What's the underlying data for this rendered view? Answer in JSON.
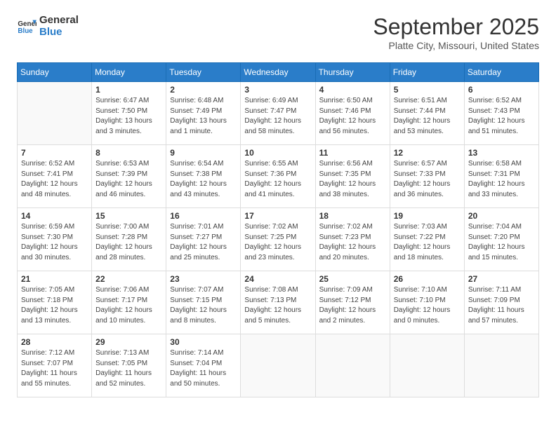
{
  "logo": {
    "line1": "General",
    "line2": "Blue"
  },
  "title": "September 2025",
  "location": "Platte City, Missouri, United States",
  "days_header": [
    "Sunday",
    "Monday",
    "Tuesday",
    "Wednesday",
    "Thursday",
    "Friday",
    "Saturday"
  ],
  "weeks": [
    [
      {
        "day": "",
        "info": ""
      },
      {
        "day": "1",
        "info": "Sunrise: 6:47 AM\nSunset: 7:50 PM\nDaylight: 13 hours\nand 3 minutes."
      },
      {
        "day": "2",
        "info": "Sunrise: 6:48 AM\nSunset: 7:49 PM\nDaylight: 13 hours\nand 1 minute."
      },
      {
        "day": "3",
        "info": "Sunrise: 6:49 AM\nSunset: 7:47 PM\nDaylight: 12 hours\nand 58 minutes."
      },
      {
        "day": "4",
        "info": "Sunrise: 6:50 AM\nSunset: 7:46 PM\nDaylight: 12 hours\nand 56 minutes."
      },
      {
        "day": "5",
        "info": "Sunrise: 6:51 AM\nSunset: 7:44 PM\nDaylight: 12 hours\nand 53 minutes."
      },
      {
        "day": "6",
        "info": "Sunrise: 6:52 AM\nSunset: 7:43 PM\nDaylight: 12 hours\nand 51 minutes."
      }
    ],
    [
      {
        "day": "7",
        "info": "Sunrise: 6:52 AM\nSunset: 7:41 PM\nDaylight: 12 hours\nand 48 minutes."
      },
      {
        "day": "8",
        "info": "Sunrise: 6:53 AM\nSunset: 7:39 PM\nDaylight: 12 hours\nand 46 minutes."
      },
      {
        "day": "9",
        "info": "Sunrise: 6:54 AM\nSunset: 7:38 PM\nDaylight: 12 hours\nand 43 minutes."
      },
      {
        "day": "10",
        "info": "Sunrise: 6:55 AM\nSunset: 7:36 PM\nDaylight: 12 hours\nand 41 minutes."
      },
      {
        "day": "11",
        "info": "Sunrise: 6:56 AM\nSunset: 7:35 PM\nDaylight: 12 hours\nand 38 minutes."
      },
      {
        "day": "12",
        "info": "Sunrise: 6:57 AM\nSunset: 7:33 PM\nDaylight: 12 hours\nand 36 minutes."
      },
      {
        "day": "13",
        "info": "Sunrise: 6:58 AM\nSunset: 7:31 PM\nDaylight: 12 hours\nand 33 minutes."
      }
    ],
    [
      {
        "day": "14",
        "info": "Sunrise: 6:59 AM\nSunset: 7:30 PM\nDaylight: 12 hours\nand 30 minutes."
      },
      {
        "day": "15",
        "info": "Sunrise: 7:00 AM\nSunset: 7:28 PM\nDaylight: 12 hours\nand 28 minutes."
      },
      {
        "day": "16",
        "info": "Sunrise: 7:01 AM\nSunset: 7:27 PM\nDaylight: 12 hours\nand 25 minutes."
      },
      {
        "day": "17",
        "info": "Sunrise: 7:02 AM\nSunset: 7:25 PM\nDaylight: 12 hours\nand 23 minutes."
      },
      {
        "day": "18",
        "info": "Sunrise: 7:02 AM\nSunset: 7:23 PM\nDaylight: 12 hours\nand 20 minutes."
      },
      {
        "day": "19",
        "info": "Sunrise: 7:03 AM\nSunset: 7:22 PM\nDaylight: 12 hours\nand 18 minutes."
      },
      {
        "day": "20",
        "info": "Sunrise: 7:04 AM\nSunset: 7:20 PM\nDaylight: 12 hours\nand 15 minutes."
      }
    ],
    [
      {
        "day": "21",
        "info": "Sunrise: 7:05 AM\nSunset: 7:18 PM\nDaylight: 12 hours\nand 13 minutes."
      },
      {
        "day": "22",
        "info": "Sunrise: 7:06 AM\nSunset: 7:17 PM\nDaylight: 12 hours\nand 10 minutes."
      },
      {
        "day": "23",
        "info": "Sunrise: 7:07 AM\nSunset: 7:15 PM\nDaylight: 12 hours\nand 8 minutes."
      },
      {
        "day": "24",
        "info": "Sunrise: 7:08 AM\nSunset: 7:13 PM\nDaylight: 12 hours\nand 5 minutes."
      },
      {
        "day": "25",
        "info": "Sunrise: 7:09 AM\nSunset: 7:12 PM\nDaylight: 12 hours\nand 2 minutes."
      },
      {
        "day": "26",
        "info": "Sunrise: 7:10 AM\nSunset: 7:10 PM\nDaylight: 12 hours\nand 0 minutes."
      },
      {
        "day": "27",
        "info": "Sunrise: 7:11 AM\nSunset: 7:09 PM\nDaylight: 11 hours\nand 57 minutes."
      }
    ],
    [
      {
        "day": "28",
        "info": "Sunrise: 7:12 AM\nSunset: 7:07 PM\nDaylight: 11 hours\nand 55 minutes."
      },
      {
        "day": "29",
        "info": "Sunrise: 7:13 AM\nSunset: 7:05 PM\nDaylight: 11 hours\nand 52 minutes."
      },
      {
        "day": "30",
        "info": "Sunrise: 7:14 AM\nSunset: 7:04 PM\nDaylight: 11 hours\nand 50 minutes."
      },
      {
        "day": "",
        "info": ""
      },
      {
        "day": "",
        "info": ""
      },
      {
        "day": "",
        "info": ""
      },
      {
        "day": "",
        "info": ""
      }
    ]
  ]
}
